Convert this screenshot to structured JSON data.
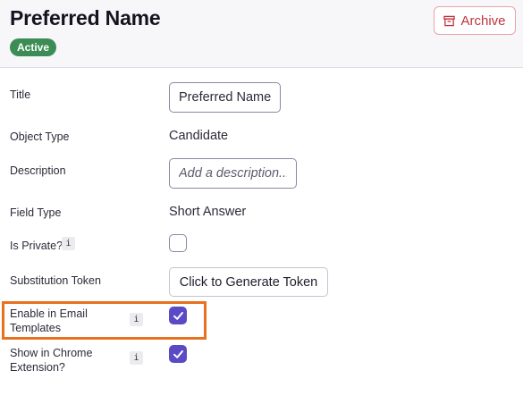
{
  "header": {
    "title": "Preferred Name",
    "status": "Active",
    "archive_label": "Archive",
    "archive_icon": "archive-box-icon"
  },
  "fields": {
    "title": {
      "label": "Title",
      "value": "Preferred Name"
    },
    "object_type": {
      "label": "Object Type",
      "value": "Candidate"
    },
    "description": {
      "label": "Description",
      "placeholder": "Add a description..."
    },
    "field_type": {
      "label": "Field Type",
      "value": "Short Answer"
    },
    "is_private": {
      "label": "Is Private?",
      "info": "i",
      "checked": false
    },
    "substitution_token": {
      "label": "Substitution Token",
      "button_label": "Click to Generate Token"
    },
    "email_templates": {
      "label_line1": "Enable in Email",
      "label_line2": "Templates",
      "info": "i",
      "checked": true
    },
    "chrome_extension": {
      "label_line1": "Show in Chrome",
      "label_line2": "Extension?",
      "info": "i",
      "checked": true
    }
  },
  "colors": {
    "accent": "#5b4ac5",
    "active_badge": "#3c8d55",
    "archive": "#c0343f",
    "highlight": "#e8701f"
  }
}
